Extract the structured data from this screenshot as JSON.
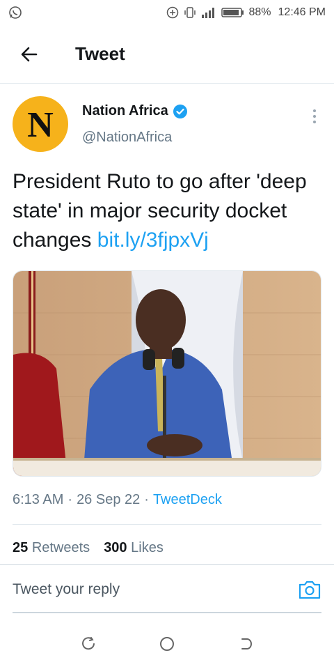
{
  "status_bar": {
    "battery": "88%",
    "time": "12:46 PM",
    "icons": [
      "whatsapp-icon",
      "data-saver-icon",
      "vibrate-icon",
      "signal-icon",
      "battery-icon"
    ]
  },
  "header": {
    "title": "Tweet",
    "back_icon": "arrow-left-icon"
  },
  "tweet": {
    "author": {
      "avatar_letter": "N",
      "name": "Nation Africa",
      "handle": "@NationAfrica",
      "verified": true
    },
    "text": "President Ruto to go after 'deep state' in major security docket changes",
    "link": "bit.ly/3fjpxVj",
    "time": "6:13 AM",
    "date": "26 Sep 22",
    "separator": "·",
    "source": "TweetDeck"
  },
  "stats": {
    "retweets_count": "25",
    "retweets_label": "Retweets",
    "likes_count": "300",
    "likes_label": "Likes"
  },
  "reply": {
    "placeholder": "Tweet your reply"
  },
  "colors": {
    "accent": "#1da1f2",
    "avatar_bg": "#f6b21b",
    "muted": "#657786"
  }
}
